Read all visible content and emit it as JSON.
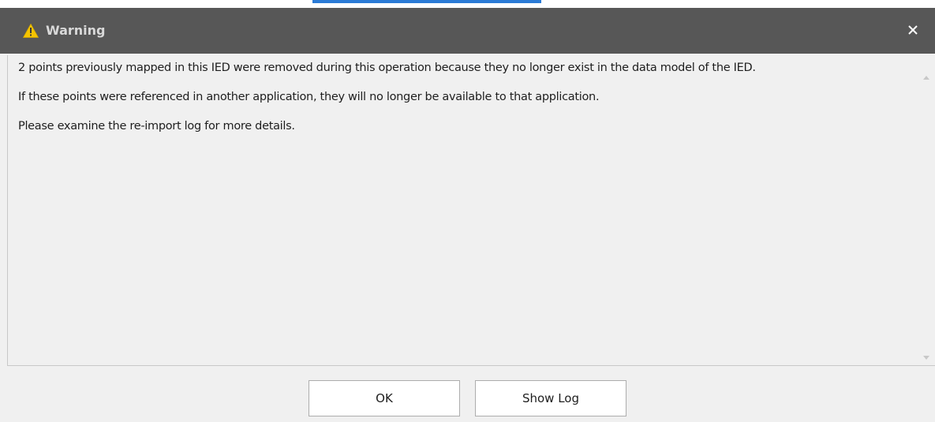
{
  "dialog": {
    "title": "Warning",
    "title_icon": "warning-triangle-icon",
    "close_icon": "close-icon",
    "messages": [
      "2 points previously mapped in this IED were removed during this operation because they no longer exist in the data model of the IED.",
      "If these points were referenced in another application, they will no longer be available to that application.",
      "Please examine the re-import log for more details."
    ],
    "buttons": {
      "ok_label": "OK",
      "show_log_label": "Show Log"
    }
  },
  "colors": {
    "titlebar": "#575757",
    "background": "#f0f0f0",
    "warning_icon": "#f5c400"
  }
}
